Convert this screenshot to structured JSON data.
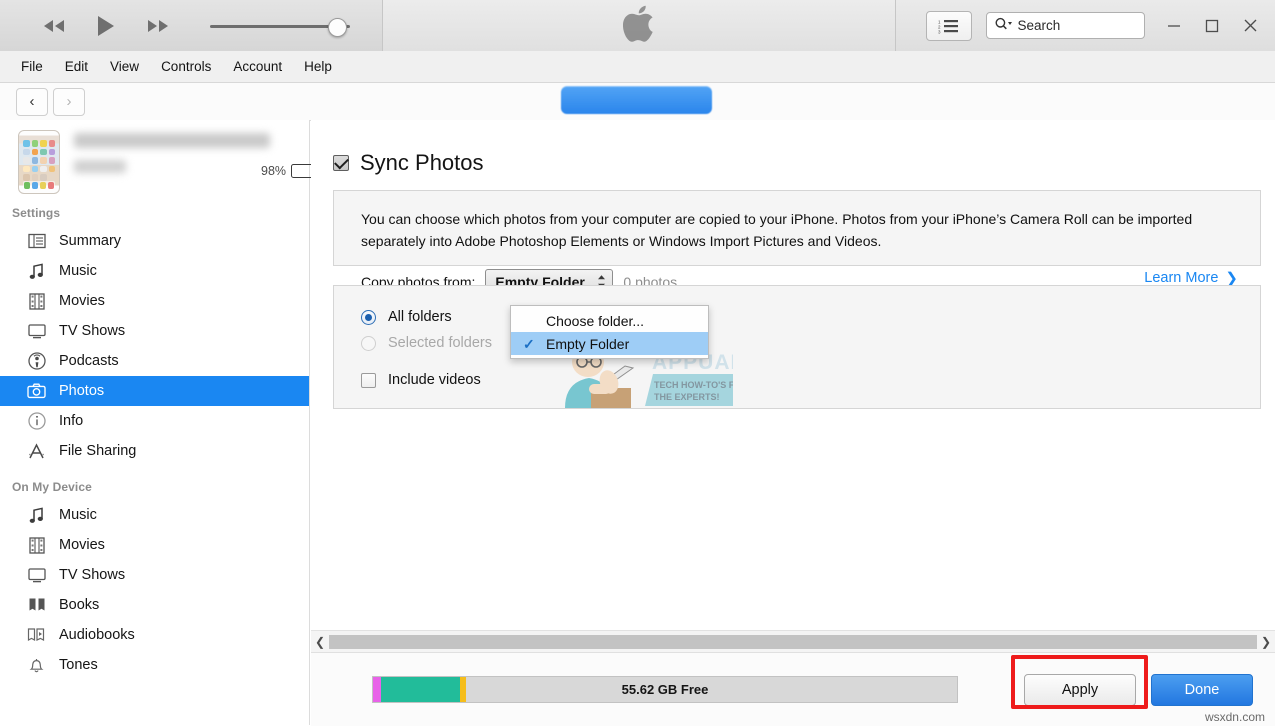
{
  "titlebar": {
    "transport": {
      "rewind": "rewind-icon",
      "play": "play-icon",
      "forward": "fast-forward-icon"
    },
    "volume_value": 84,
    "apple_logo": "apple-logo-icon",
    "list_button": "list-view-icon",
    "search": {
      "placeholder": "Search",
      "value": "",
      "icon": "search-icon"
    },
    "window": {
      "minimize": "—",
      "maximize": "□",
      "close": "✕"
    }
  },
  "menubar": {
    "items": [
      {
        "label": "File"
      },
      {
        "label": "Edit"
      },
      {
        "label": "View"
      },
      {
        "label": "Controls"
      },
      {
        "label": "Account"
      },
      {
        "label": "Help"
      }
    ]
  },
  "navbar": {
    "back": "‹",
    "forward": "›"
  },
  "sidebar": {
    "device": {
      "name": "",
      "subtitle": "",
      "battery_percent": "98%",
      "charging": true,
      "eject": "eject-icon"
    },
    "sections": [
      {
        "title": "Settings",
        "items": [
          {
            "label": "Summary",
            "icon": "summary-icon",
            "selected": false
          },
          {
            "label": "Music",
            "icon": "music-note-icon",
            "selected": false
          },
          {
            "label": "Movies",
            "icon": "film-icon",
            "selected": false
          },
          {
            "label": "TV Shows",
            "icon": "tv-icon",
            "selected": false
          },
          {
            "label": "Podcasts",
            "icon": "podcast-icon",
            "selected": false
          },
          {
            "label": "Photos",
            "icon": "camera-icon",
            "selected": true
          },
          {
            "label": "Info",
            "icon": "info-circle-icon",
            "selected": false
          },
          {
            "label": "File Sharing",
            "icon": "app-store-icon",
            "selected": false
          }
        ]
      },
      {
        "title": "On My Device",
        "items": [
          {
            "label": "Music",
            "icon": "music-note-icon",
            "selected": false
          },
          {
            "label": "Movies",
            "icon": "film-icon",
            "selected": false
          },
          {
            "label": "TV Shows",
            "icon": "tv-icon",
            "selected": false
          },
          {
            "label": "Books",
            "icon": "books-icon",
            "selected": false
          },
          {
            "label": "Audiobooks",
            "icon": "audiobook-icon",
            "selected": false
          },
          {
            "label": "Tones",
            "icon": "bell-icon",
            "selected": false
          }
        ]
      }
    ]
  },
  "main": {
    "sync_photos_label": "Sync Photos",
    "sync_photos_checked": true,
    "description": "You can choose which photos from your computer are copied to your iPhone. Photos from your iPhone’s Camera Roll can be imported separately into Adobe Photoshop Elements or Windows Import Pictures and Videos.",
    "copy_from_label": "Copy photos from:",
    "copy_from_value": "Empty Folder",
    "photo_count": "0 photos",
    "learn_more": "Learn More",
    "dropdown": {
      "open": true,
      "options": [
        {
          "label": "Choose folder...",
          "checked": false,
          "highlighted": false
        },
        {
          "label": "Empty Folder",
          "checked": true,
          "highlighted": true
        }
      ]
    },
    "folder_options": [
      {
        "label": "All folders",
        "selected": true,
        "disabled": false
      },
      {
        "label": "Selected folders",
        "selected": false,
        "disabled": true
      }
    ],
    "include_videos": {
      "label": "Include videos",
      "checked": false
    }
  },
  "watermark": {
    "brand": "APPUALS",
    "tagline_line1": "TECH HOW-TO'S FROM",
    "tagline_line2": "THE EXPERTS!"
  },
  "bottombar": {
    "capacity_label": "55.62 GB Free",
    "capacity_segments": [
      {
        "name": "photos",
        "color": "#e862e8",
        "percent": 1.4
      },
      {
        "name": "audio",
        "color": "#22bc9a",
        "percent": 13.5
      },
      {
        "name": "documents",
        "color": "#f5bd1a",
        "percent": 1.1
      },
      {
        "name": "free",
        "color": "#d8d8d8",
        "percent": 84.0
      }
    ],
    "apply_label": "Apply",
    "done_label": "Done",
    "source_watermark": "wsxdn.com"
  },
  "colors": {
    "accent_blue": "#1a87f2",
    "selected_sidebar": "#1a87f2",
    "annotation_red": "#ee1b1b",
    "battery_green": "#2fd02f"
  }
}
